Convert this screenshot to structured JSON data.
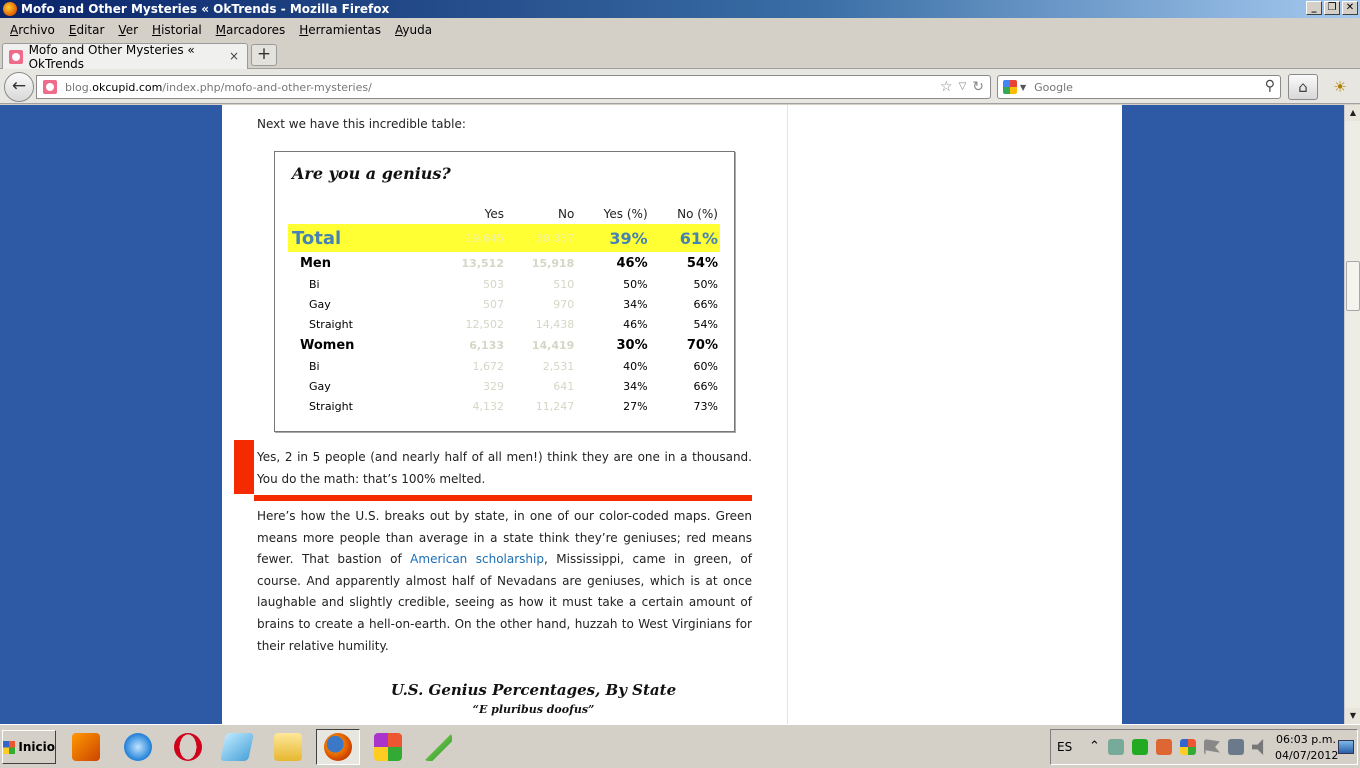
{
  "window": {
    "title": "Mofo and Other Mysteries « OkTrends - Mozilla Firefox",
    "minimize": "_",
    "restore": "❐",
    "close": "✕"
  },
  "menu": [
    "Archivo",
    "Editar",
    "Ver",
    "Historial",
    "Marcadores",
    "Herramientas",
    "Ayuda"
  ],
  "tab": {
    "label": "Mofo and Other Mysteries « OkTrends",
    "close": "×",
    "new_tab": "+"
  },
  "nav": {
    "url_prefix": "blog.",
    "url_domain": "okcupid.com",
    "url_path": "/index.php/mofo-and-other-mysteries/",
    "search_placeholder": "Google"
  },
  "article": {
    "intro": "Next we have this incredible table:",
    "table": {
      "title": "Are you a genius?",
      "headers": [
        "Yes",
        "No",
        "Yes (%)",
        "No (%)"
      ],
      "rows": [
        {
          "kind": "total",
          "label": "Total",
          "yes": "19,645",
          "no": "30,337",
          "yes_pct": "39%",
          "no_pct": "61%"
        },
        {
          "kind": "group",
          "label": "Men",
          "yes": "13,512",
          "no": "15,918",
          "yes_pct": "46%",
          "no_pct": "54%"
        },
        {
          "kind": "sub",
          "label": "Bi",
          "yes": "503",
          "no": "510",
          "yes_pct": "50%",
          "no_pct": "50%"
        },
        {
          "kind": "sub",
          "label": "Gay",
          "yes": "507",
          "no": "970",
          "yes_pct": "34%",
          "no_pct": "66%"
        },
        {
          "kind": "sub",
          "label": "Straight",
          "yes": "12,502",
          "no": "14,438",
          "yes_pct": "46%",
          "no_pct": "54%"
        },
        {
          "kind": "group",
          "label": "Women",
          "yes": "6,133",
          "no": "14,419",
          "yes_pct": "30%",
          "no_pct": "70%"
        },
        {
          "kind": "sub",
          "label": "Bi",
          "yes": "1,672",
          "no": "2,531",
          "yes_pct": "40%",
          "no_pct": "60%"
        },
        {
          "kind": "sub",
          "label": "Gay",
          "yes": "329",
          "no": "641",
          "yes_pct": "34%",
          "no_pct": "66%"
        },
        {
          "kind": "sub",
          "label": "Straight",
          "yes": "4,132",
          "no": "11,247",
          "yes_pct": "27%",
          "no_pct": "73%"
        }
      ]
    },
    "callout": "Yes, 2 in 5 people (and nearly half of all men!) think they are one in a thousand. You do the math: that’s 100% melted.",
    "para_before_link": "Here’s how the U.S. breaks out by state, in one of our color-coded maps. Green means more people than average in a state think they’re geniuses; red means fewer. That bastion of ",
    "para_link": "American scholarship",
    "para_after_link": ", Mississippi, came in green, of course. And apparently almost half of Nevadans are geniuses, which is at once laughable and slightly credible, seeing as how it must take a certain amount of brains to create a hell-on-earth. On the other hand, huzzah to West Virginians for their relative humility.",
    "map_title": "U.S. Genius Percentages, By State",
    "map_subtitle": "“E pluribus doofus”"
  },
  "scrollbar": {
    "up": "▲",
    "down": "▼"
  },
  "taskbar": {
    "start_label": "Inicio",
    "language": "ES",
    "clock_time": "06:03 p.m.",
    "clock_date": "04/07/2012",
    "tray_expand": "⌃"
  },
  "colors": {
    "highlight_yellow": "#ffff33",
    "accent_red": "#f52a00",
    "total_blue": "#4682b4",
    "link_blue": "#1b6eb5",
    "page_bg_blue": "#2e5aa5"
  }
}
